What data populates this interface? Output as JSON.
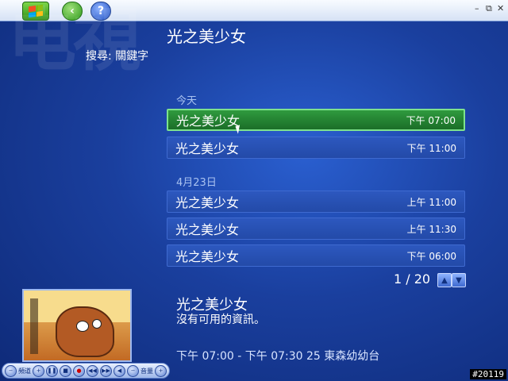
{
  "window_controls": {
    "minimize": "–",
    "restore": "⧉",
    "close": "✕"
  },
  "watermark": "电視",
  "page_title": "光之美少女",
  "search": {
    "label": "搜尋: 關鍵字"
  },
  "groups": [
    {
      "label": "今天",
      "items": [
        {
          "title": "光之美少女",
          "time": "下午 07:00",
          "selected": true
        },
        {
          "title": "光之美少女",
          "time": "下午 11:00",
          "selected": false
        }
      ]
    },
    {
      "label": "4月23日",
      "items": [
        {
          "title": "光之美少女",
          "time": "上午 11:00",
          "selected": false
        },
        {
          "title": "光之美少女",
          "time": "上午 11:30",
          "selected": false
        },
        {
          "title": "光之美少女",
          "time": "下午 06:00",
          "selected": false
        }
      ]
    }
  ],
  "pager": {
    "text": "1 / 20",
    "up": "▲",
    "down": "▼"
  },
  "detail": {
    "title": "光之美少女",
    "description": "沒有可用的資訊。",
    "time_channel": "下午 07:00 - 下午 07:30    25 東森幼幼台"
  },
  "transport": {
    "channel_label": "頻道",
    "volume_label": "音量",
    "icons": [
      "channel-minus-icon",
      "channel-plus-icon",
      "pause-icon",
      "stop-icon",
      "record-icon",
      "rewind-icon",
      "fast-forward-icon",
      "mute-icon",
      "volume-minus-icon",
      "volume-plus-icon"
    ]
  },
  "corner_tag": "#20119",
  "colors": {
    "accent_green": "#2f9a3e",
    "row_blue": "#2d58bf",
    "background": "#1a3f9e"
  }
}
